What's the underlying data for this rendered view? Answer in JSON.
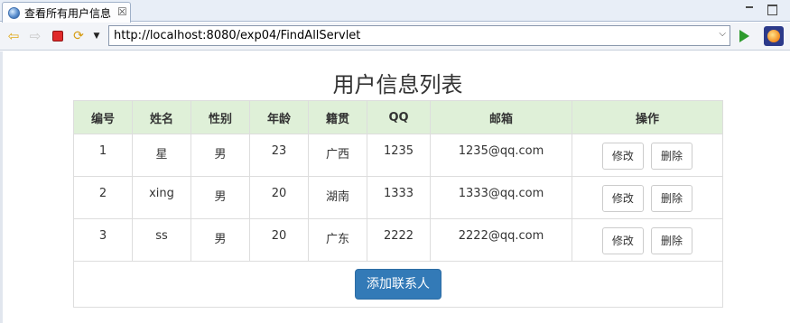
{
  "browser": {
    "tab_title": "查看所有用户信息",
    "tab_close": "☒",
    "url": "http://localhost:8080/exp04/FindAllServlet"
  },
  "page": {
    "title": "用户信息列表",
    "columns": [
      "编号",
      "姓名",
      "性别",
      "年龄",
      "籍贯",
      "QQ",
      "邮箱",
      "操作"
    ],
    "rows": [
      {
        "id": "1",
        "name": "星",
        "gender": "男",
        "age": "23",
        "hometown": "广西",
        "qq": "1235",
        "email": "1235@qq.com",
        "edit": "修改",
        "delete": "删除"
      },
      {
        "id": "2",
        "name": "xing",
        "gender": "男",
        "age": "20",
        "hometown": "湖南",
        "qq": "1333",
        "email": "1333@qq.com",
        "edit": "修改",
        "delete": "删除"
      },
      {
        "id": "3",
        "name": "ss",
        "gender": "男",
        "age": "20",
        "hometown": "广东",
        "qq": "2222",
        "email": "2222@qq.com",
        "edit": "修改",
        "delete": "删除"
      }
    ],
    "add_button": "添加联系人"
  },
  "colors": {
    "header_bg": "#dff0d8",
    "primary": "#337ab7",
    "border": "#dddddd"
  },
  "icons": [
    "globe-icon",
    "close-icon",
    "minimize-icon",
    "maximize-icon",
    "back-arrow-icon",
    "forward-arrow-icon",
    "stop-icon",
    "refresh-icon",
    "dropdown-icon",
    "go-icon",
    "eclipse-icon"
  ]
}
